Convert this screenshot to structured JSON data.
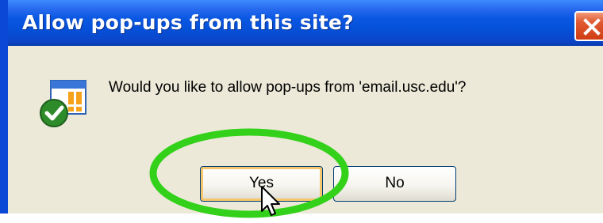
{
  "dialog": {
    "title": "Allow pop-ups from this site?",
    "message": "Would you like to allow pop-ups from 'email.usc.edu'?"
  },
  "buttons": {
    "yes": "Yes",
    "no": "No"
  },
  "icons": {
    "close": "close-icon",
    "popup_prompt": "popup-allow-icon",
    "cursor": "mouse-pointer-icon"
  },
  "colors": {
    "titlebar": "#0a57e2",
    "dialog_background": "#ece9d8",
    "highlight_circle": "#33d11a",
    "close_button": "#d84a22"
  }
}
